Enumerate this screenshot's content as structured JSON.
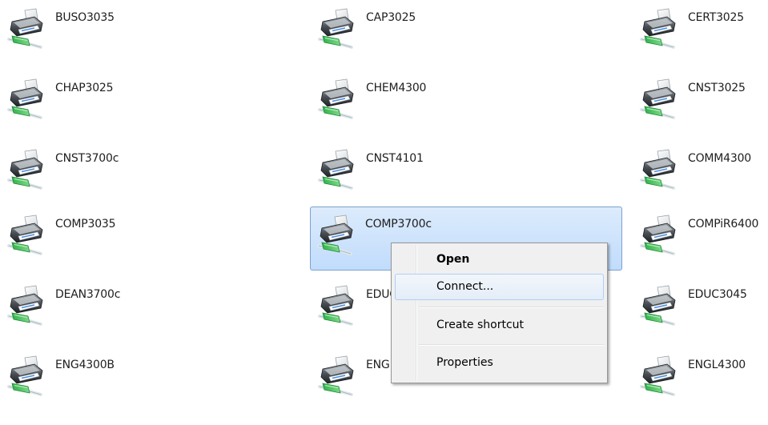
{
  "printers": [
    {
      "name": "BUSO3035"
    },
    {
      "name": "CAP3025"
    },
    {
      "name": "CERT3025"
    },
    {
      "name": "CHAP3025"
    },
    {
      "name": "CHEM4300"
    },
    {
      "name": "CNST3025"
    },
    {
      "name": "CNST3700c"
    },
    {
      "name": "CNST4101"
    },
    {
      "name": "COMM4300"
    },
    {
      "name": "COMP3035"
    },
    {
      "name": "COMP3700c",
      "selected": true
    },
    {
      "name": "COMPiR6400"
    },
    {
      "name": "DEAN3700c"
    },
    {
      "name": "EDUC3025"
    },
    {
      "name": "EDUC3045"
    },
    {
      "name": "ENG4300B"
    },
    {
      "name": "ENGL3025"
    },
    {
      "name": "ENGL4300"
    }
  ],
  "context_menu": {
    "open": "Open",
    "connect": "Connect...",
    "create_shortcut": "Create shortcut",
    "properties": "Properties"
  },
  "icon": {
    "name": "network-printer-icon",
    "accent": "#2fb34a",
    "cable": "#dfe7ea"
  }
}
